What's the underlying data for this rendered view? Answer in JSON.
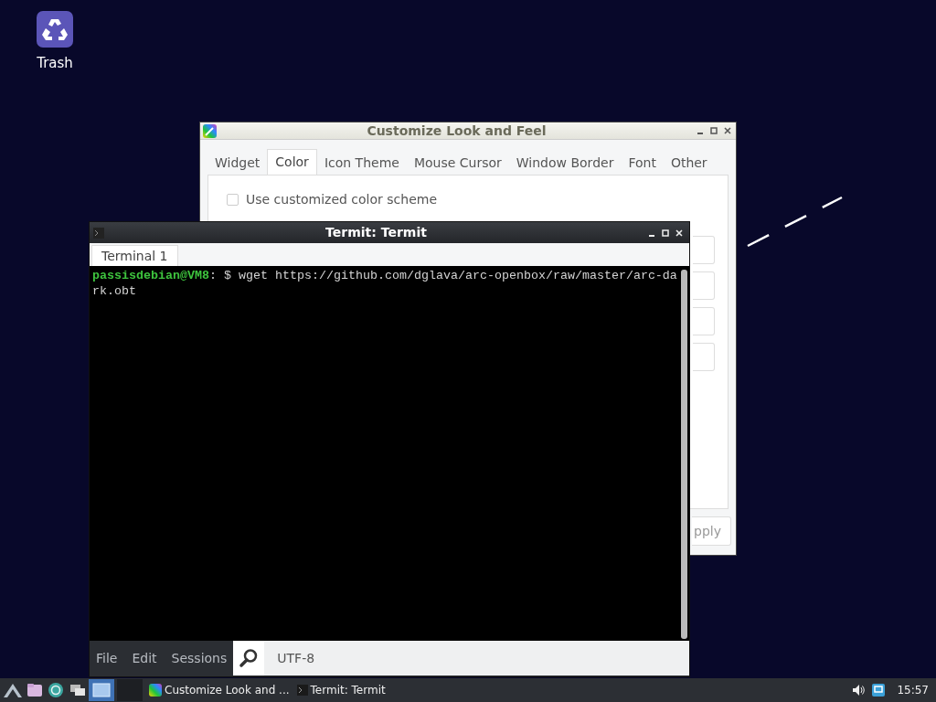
{
  "desktop_icons": [
    {
      "label": "Trash"
    }
  ],
  "customize_window": {
    "title": "Customize Look and Feel",
    "tabs": [
      {
        "label": "Widget",
        "selected": false
      },
      {
        "label": "Color",
        "selected": true
      },
      {
        "label": "Icon Theme",
        "selected": false
      },
      {
        "label": "Mouse Cursor",
        "selected": false
      },
      {
        "label": "Window Border",
        "selected": false
      },
      {
        "label": "Font",
        "selected": false
      },
      {
        "label": "Other",
        "selected": false
      }
    ],
    "checkbox": {
      "label": "Use customized color scheme",
      "checked": false
    },
    "apply_button": "pply"
  },
  "terminal_window": {
    "title": "Termit: Termit",
    "tabs": [
      {
        "label": "Terminal 1",
        "selected": true
      }
    ],
    "prompt": "passisdebian@VM8",
    "command": ": $ wget https://github.com/dglava/arc-openbox/raw/master/arc-dark.obt",
    "menu": [
      "File",
      "Edit",
      "Sessions"
    ],
    "encoding": "UTF-8"
  },
  "taskbar": {
    "tasks": [
      {
        "label": "Customize Look and ...",
        "kind": "palette"
      },
      {
        "label": "Termit: Termit",
        "kind": "terminal"
      }
    ],
    "clock": "15:57"
  }
}
